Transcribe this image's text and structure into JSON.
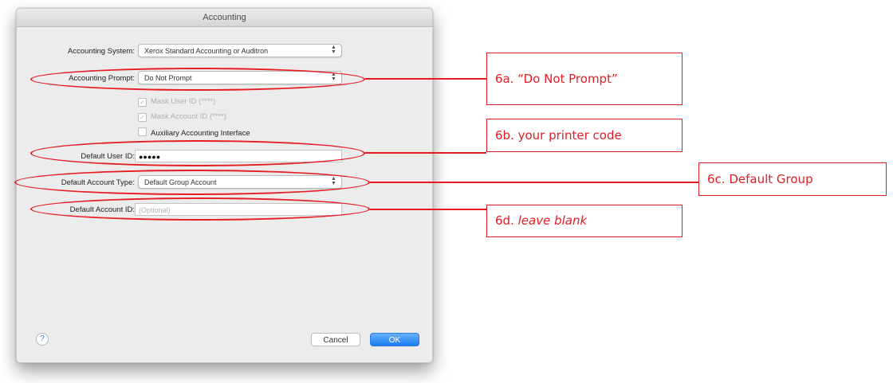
{
  "window": {
    "title": "Accounting"
  },
  "form": {
    "accounting_system": {
      "label": "Accounting System:",
      "value": "Xerox Standard Accounting or Auditron"
    },
    "accounting_prompt": {
      "label": "Accounting Prompt:",
      "value": "Do Not Prompt"
    },
    "checkboxes": [
      {
        "label": "Mask User ID (****)",
        "checked": true,
        "enabled": false
      },
      {
        "label": "Mask Account ID (****)",
        "checked": true,
        "enabled": false
      },
      {
        "label": "Auxiliary Accounting Interface",
        "checked": false,
        "enabled": true
      }
    ],
    "default_user_id": {
      "label": "Default User ID:",
      "value": "●●●●●"
    },
    "default_account_type": {
      "label": "Default Account Type:",
      "value": "Default Group Account"
    },
    "default_account_id": {
      "label": "Default Account ID:",
      "placeholder": "(Optional)"
    }
  },
  "buttons": {
    "help": "?",
    "cancel": "Cancel",
    "ok": "OK"
  },
  "annotations": {
    "a": {
      "prefix": "6a.",
      "text": "“Do Not Prompt”"
    },
    "b": {
      "prefix": "6b.",
      "text": "your printer code"
    },
    "c": {
      "prefix": "6c.",
      "text": "Default Group"
    },
    "d": {
      "prefix": "6d.",
      "text": "leave blank"
    }
  },
  "colors": {
    "annotation": "#e51c23",
    "accent": "#1a7cf1"
  }
}
